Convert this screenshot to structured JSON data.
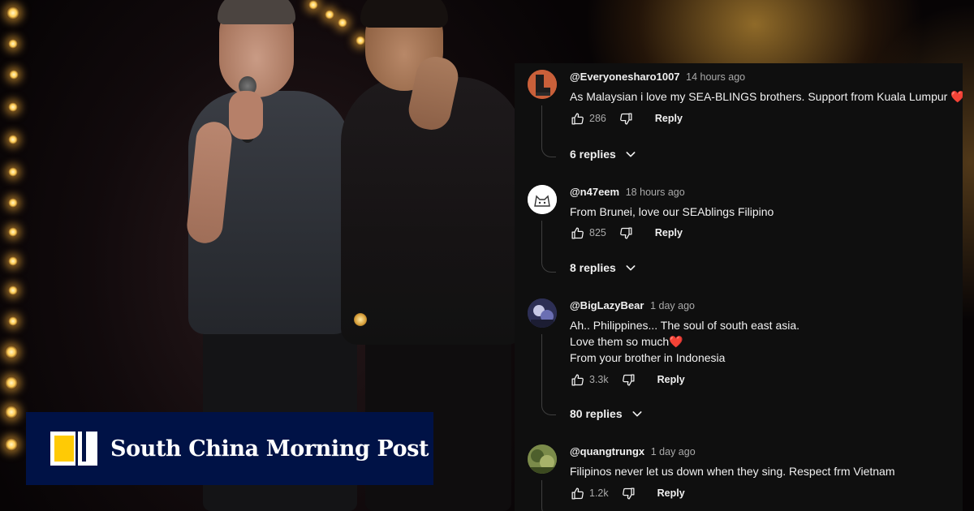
{
  "brand": {
    "name": "South China Morning Post",
    "colors": {
      "navy": "#001246",
      "yellow": "#ffca05"
    }
  },
  "comments_panel": {
    "theme_bg": "#0f0f0f",
    "reply_label": "Reply",
    "comments": [
      {
        "author": "@Everyonesharo1007",
        "time": "14 hours ago",
        "lines": [
          "As Malaysian i love my SEA-BLINGS brothers. Support from Kuala Lumpur"
        ],
        "heart": "❤️",
        "likes": "286",
        "replies": "6 replies",
        "avatar_icon": "dark-boot-avatar"
      },
      {
        "author": "@n47eem",
        "time": "18 hours ago",
        "lines": [
          "From Brunei, love our SEAblings Filipino"
        ],
        "heart": "",
        "likes": "825",
        "replies": "8 replies",
        "avatar_icon": "cat-sketch-avatar"
      },
      {
        "author": "@BigLazyBear",
        "time": "1 day ago",
        "lines": [
          "Ah.. Philippines... The soul of south east asia.",
          "Love them so much",
          "From your brother in Indonesia"
        ],
        "heart": "❤️",
        "likes": "3.3k",
        "replies": "80 replies",
        "avatar_icon": "photo-avatar"
      },
      {
        "author": "@quangtrungx",
        "time": "1 day ago",
        "lines": [
          "Filipinos never let us down when they sing. Respect frm Vietnam"
        ],
        "heart": "",
        "likes": "1.2k",
        "replies": "",
        "avatar_icon": "landscape-avatar"
      }
    ]
  }
}
